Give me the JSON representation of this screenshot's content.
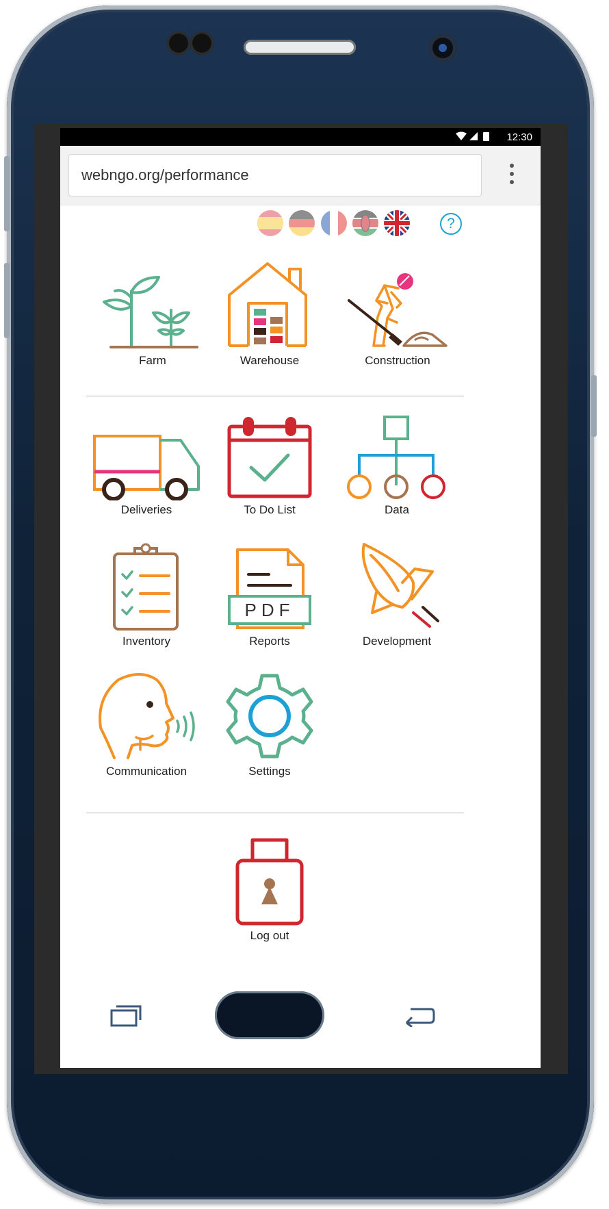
{
  "status_bar": {
    "time": "12:30"
  },
  "browser": {
    "url": "webngo.org/performance"
  },
  "languages": [
    {
      "name": "spanish-flag",
      "active": false
    },
    {
      "name": "german-flag",
      "active": false
    },
    {
      "name": "french-flag",
      "active": false
    },
    {
      "name": "kenyan-flag",
      "active": false
    },
    {
      "name": "uk-flag",
      "active": true
    }
  ],
  "help": {
    "symbol": "?"
  },
  "tiles": {
    "farm": "Farm",
    "warehouse": "Warehouse",
    "construction": "Construction",
    "deliveries": "Deliveries",
    "todo": "To Do List",
    "data": "Data",
    "inventory": "Inventory",
    "reports": "Reports",
    "reports_pdf": "PDF",
    "development": "Development",
    "communication": "Communication",
    "settings": "Settings",
    "logout": "Log out"
  },
  "colors": {
    "green": "#5bb08e",
    "orange": "#f39325",
    "brown": "#a47550",
    "red": "#d0262f",
    "pink": "#e8347f",
    "blue": "#1da1d4",
    "dark": "#3a2318"
  }
}
